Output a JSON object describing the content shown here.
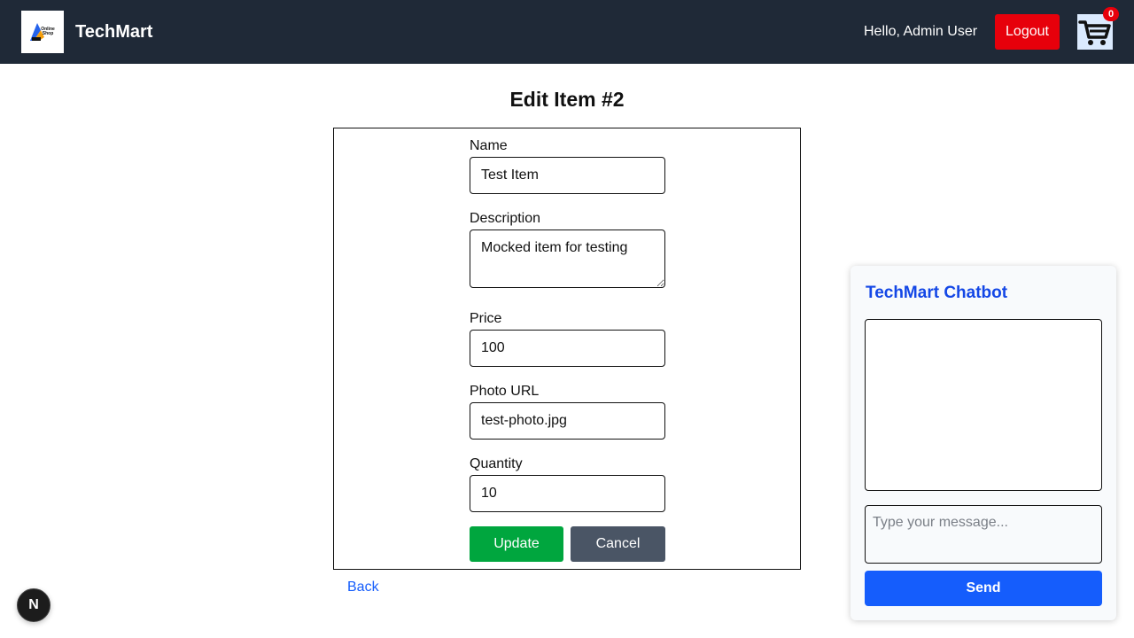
{
  "header": {
    "logo_text": "Online Shop",
    "brand": "TechMart",
    "greeting": "Hello, Admin User",
    "logout_label": "Logout",
    "cart_count": "0"
  },
  "page": {
    "title": "Edit Item #2"
  },
  "form": {
    "name": {
      "label": "Name",
      "value": "Test Item"
    },
    "description": {
      "label": "Description",
      "value": "Mocked item for testing"
    },
    "price": {
      "label": "Price",
      "value": "100"
    },
    "photo_url": {
      "label": "Photo URL",
      "value": "test-photo.jpg"
    },
    "quantity": {
      "label": "Quantity",
      "value": "10"
    },
    "update_label": "Update",
    "cancel_label": "Cancel"
  },
  "back_link": "Back",
  "next_indicator": "N",
  "chatbot": {
    "title": "TechMart Chatbot",
    "input_placeholder": "Type your message...",
    "send_label": "Send"
  },
  "colors": {
    "header_bg": "#1f2937",
    "logout": "#e7000b",
    "update": "#00a63e",
    "cancel": "#4a5565",
    "link": "#155dfc",
    "chat_title": "#1447e6",
    "send": "#155dfc"
  }
}
